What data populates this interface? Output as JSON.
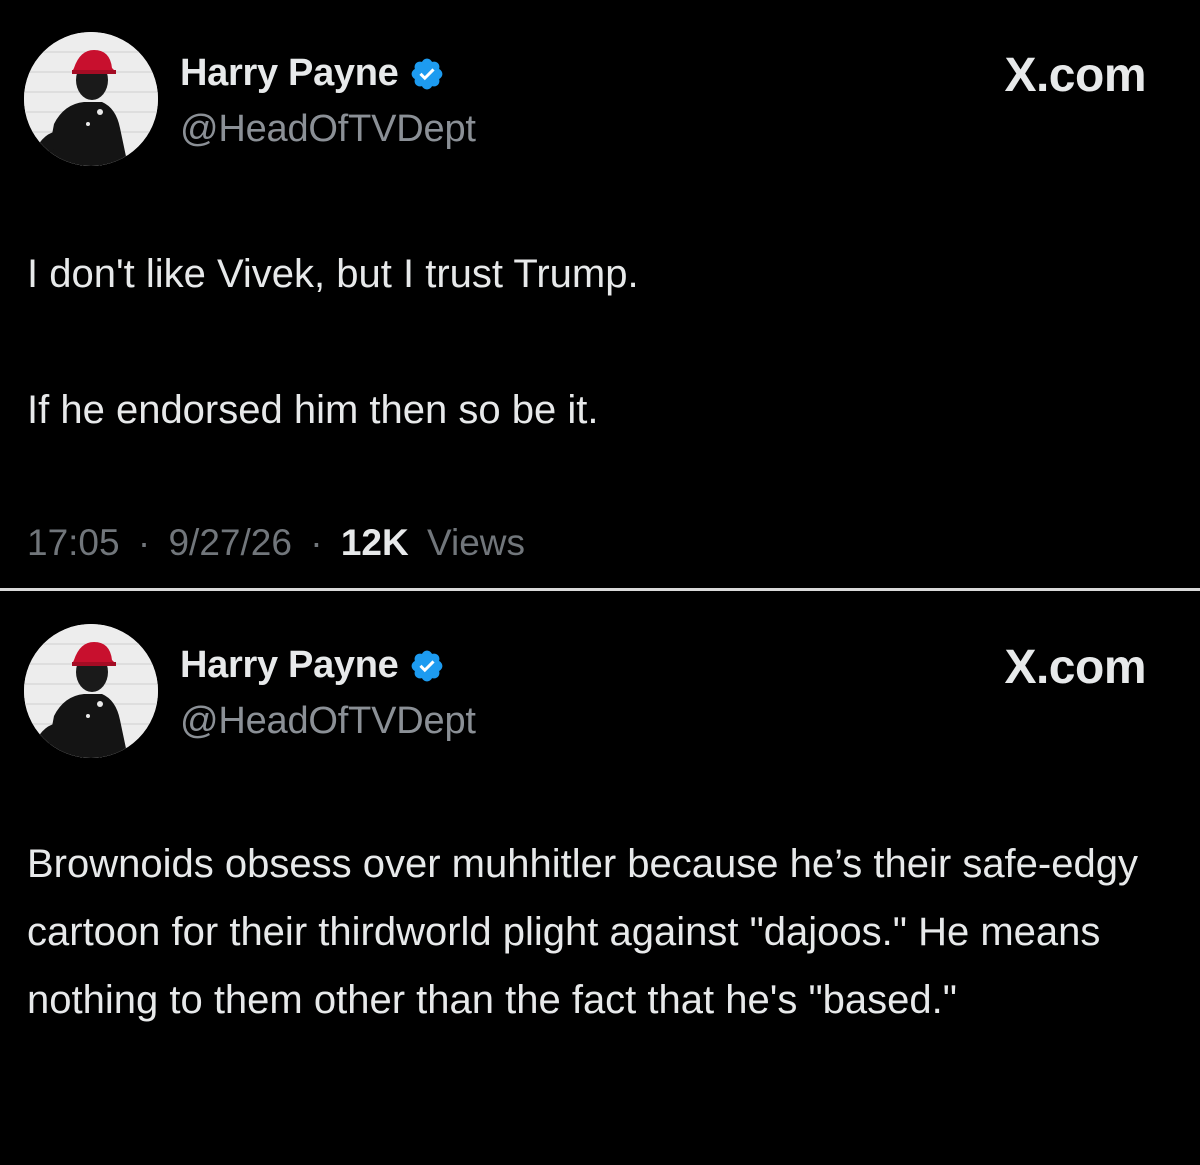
{
  "tweets": [
    {
      "author": {
        "display_name": "Harry Payne",
        "handle": "@HeadOfTVDept",
        "verified": true
      },
      "site_label": "X.com",
      "paragraphs": [
        "I don't like Vivek, but I trust Trump.",
        "If he endorsed him then so be it."
      ],
      "meta": {
        "time": "17:05",
        "separator": "·",
        "date": "9/27/26",
        "views_count": "12K",
        "views_label": "Views"
      }
    },
    {
      "author": {
        "display_name": "Harry Payne",
        "handle": "@HeadOfTVDept",
        "verified": true
      },
      "site_label": "X.com",
      "paragraphs": [
        "Brownoids obsess over muhhitler because he’s their safe-edgy cartoon for their thirdworld plight against \"dajoos.\" He means nothing to them other than the fact that he's \"based.\""
      ]
    }
  ],
  "colors": {
    "background": "#000000",
    "text_primary": "#e7e9ea",
    "text_secondary": "#71767b",
    "verified_badge": "#1d9bf0",
    "divider": "#d9d9d9",
    "hat_red": "#c8102e"
  },
  "icons": {
    "verified": "verified-badge-icon",
    "avatar": "avatar-image"
  }
}
